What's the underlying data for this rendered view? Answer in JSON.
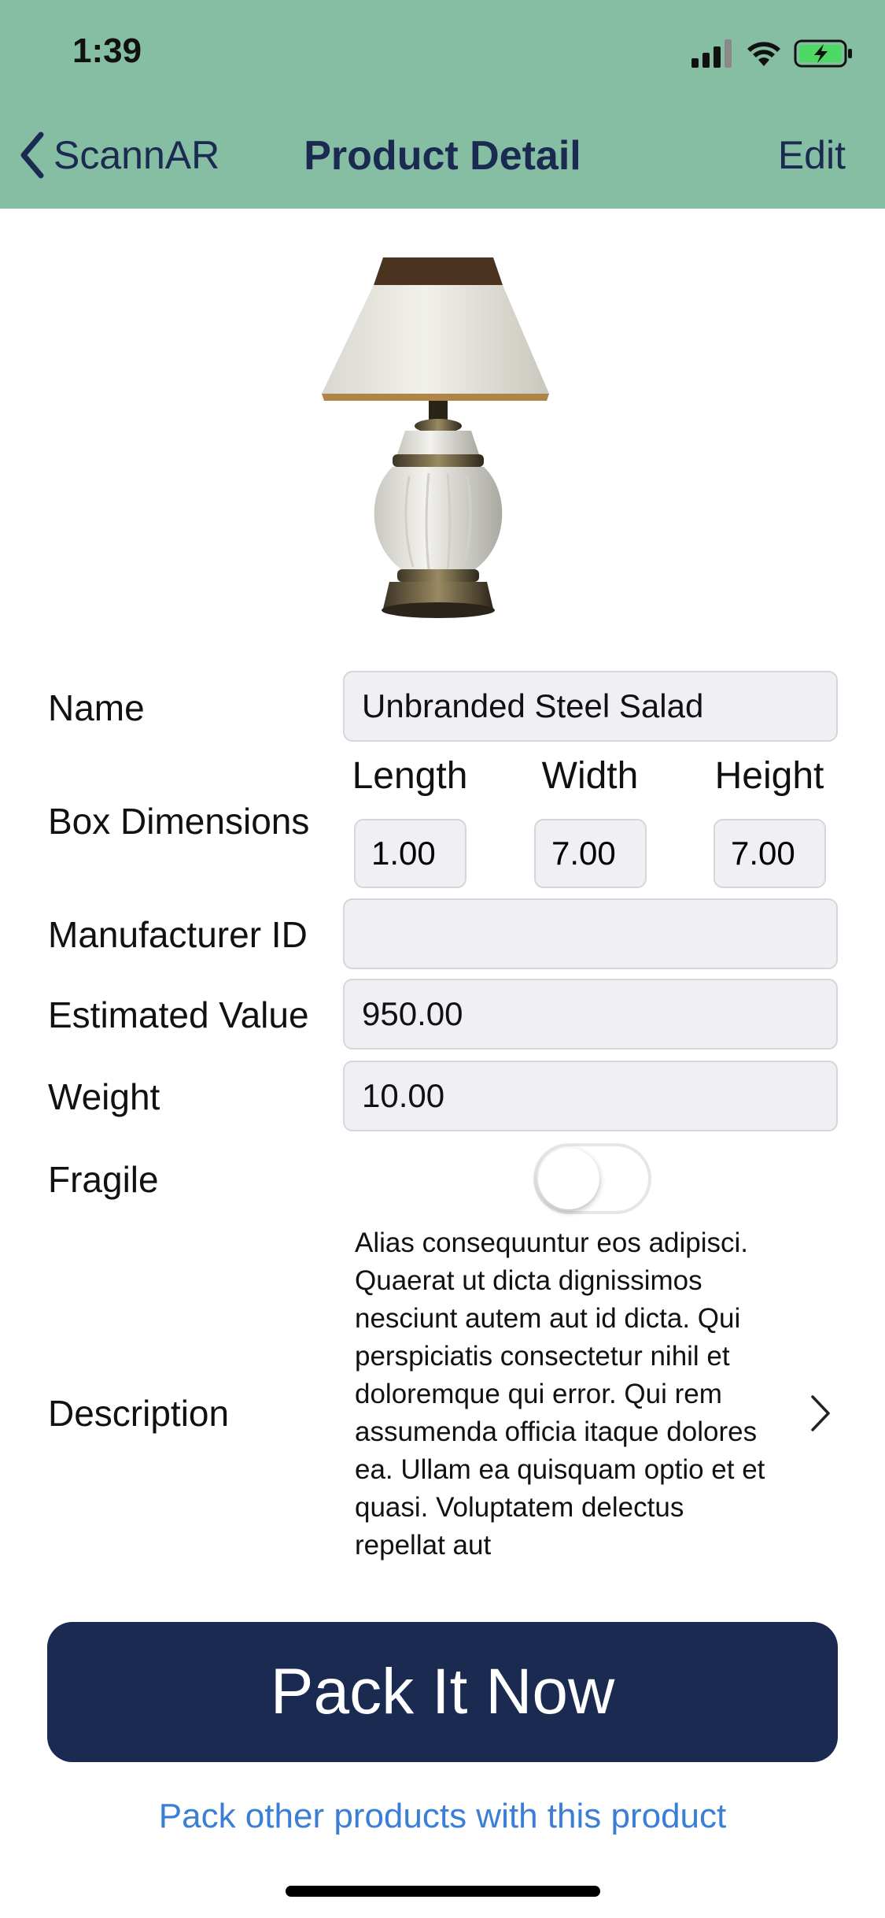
{
  "status_bar": {
    "time": "1:39",
    "icons": [
      "signal-icon",
      "wifi-icon",
      "battery-charging-icon"
    ]
  },
  "nav": {
    "back_label": "ScannAR",
    "title": "Product Detail",
    "edit_label": "Edit"
  },
  "form": {
    "name_label": "Name",
    "name_value": "Unbranded Steel Salad",
    "box_label": "Box Dimensions",
    "length_label": "Length",
    "width_label": "Width",
    "height_label": "Height",
    "length_value": "1.00",
    "width_value": "7.00",
    "height_value": "7.00",
    "manufacturer_label": "Manufacturer ID",
    "manufacturer_value": "",
    "estimated_label": "Estimated Value",
    "estimated_value": "950.00",
    "weight_label": "Weight",
    "weight_value": "10.00",
    "fragile_label": "Fragile",
    "fragile_on": false,
    "description_label": "Description",
    "description_text": "Alias consequuntur eos adipisci. Quaerat ut dicta dignissimos nesciunt autem aut id dicta. Qui perspiciatis consectetur nihil et doloremque qui error. Qui rem assumenda officia itaque dolores ea. Ullam ea quisquam optio et et quasi. Voluptatem delectus repellat aut"
  },
  "actions": {
    "pack_button": "Pack It Now",
    "pack_other_link": "Pack other products with this product"
  },
  "colors": {
    "header_bg": "#86bea4",
    "primary_navy": "#1a2a50",
    "link_blue": "#3a7fd5"
  }
}
